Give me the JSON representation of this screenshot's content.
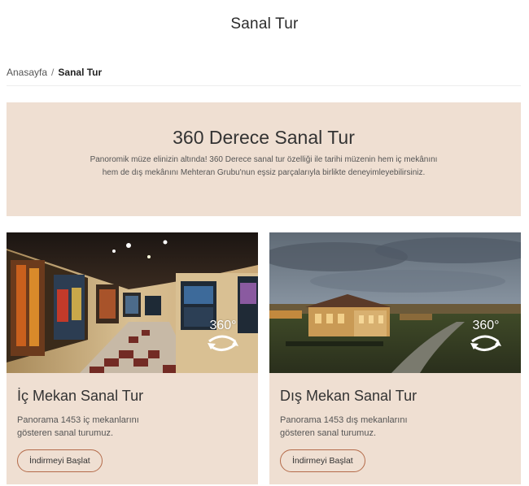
{
  "header": {
    "title": "Sanal Tur"
  },
  "breadcrumb": {
    "home": "Anasayfa",
    "separator": "/",
    "current": "Sanal Tur"
  },
  "hero": {
    "title": "360 Derece Sanal Tur",
    "description": "Panoromik müze elinizin altında! 360 Derece sanal tur özelliği ile tarihi müzenin hem iç mekânını hem de dış mekânını Mehteran Grubu'nun eşsiz parçalarıyla birlikte deneyimleyebilirsiniz."
  },
  "cards": [
    {
      "title": "İç Mekan Sanal Tur",
      "description": "Panorama 1453 iç mekanlarını gösteren sanal turumuz.",
      "button": "İndirmeyi Başlat",
      "badge": "360°"
    },
    {
      "title": "Dış Mekan Sanal Tur",
      "description": "Panorama 1453 dış mekanlarını gösteren sanal turumuz.",
      "button": "İndirmeyi Başlat",
      "badge": "360°"
    }
  ],
  "colors": {
    "card_bg": "#efdfd2",
    "button_border": "#b46b4a"
  },
  "icons": {
    "rotate": "rotate-360-icon"
  }
}
